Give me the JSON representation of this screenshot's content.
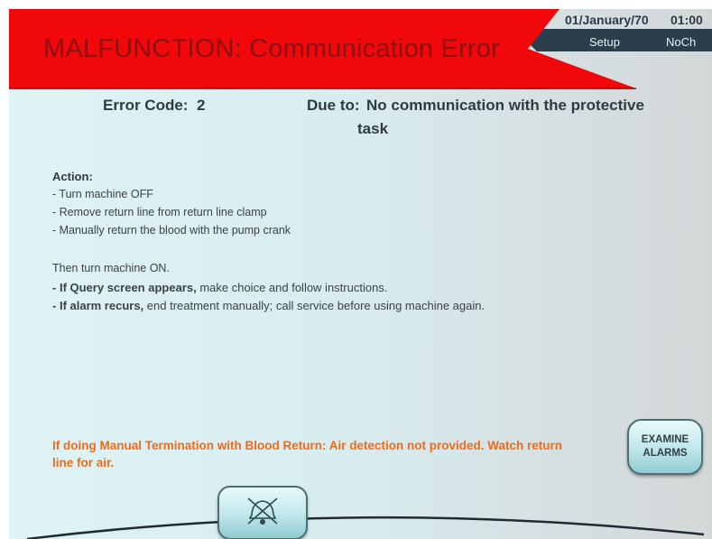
{
  "header": {
    "title": "MALFUNCTION: Communication Error",
    "date": "01/January/70",
    "time": "01:00",
    "tabs": {
      "setup": "Setup",
      "noch": "NoCh"
    }
  },
  "error": {
    "code_label": "Error Code:",
    "code_value": "2",
    "due_label": "Due to:",
    "due_line1": "No communication with the protective",
    "due_line2": "task"
  },
  "action": {
    "title": "Action:",
    "steps": [
      "- Turn machine OFF",
      "- Remove return line from return line clamp",
      "- Manually return the blood with the pump crank"
    ],
    "then": "Then turn machine ON.",
    "ifs": [
      {
        "prefix": "- ",
        "bold": "If Query screen appears,",
        "rest": " make choice and follow instructions."
      },
      {
        "prefix": "- ",
        "bold": "If alarm recurs,",
        "rest": " end treatment manually; call service before using machine again."
      }
    ]
  },
  "warning": "If doing Manual Termination with Blood Return: Air detection not provided. Watch return line for air.",
  "buttons": {
    "examine_line1": "EXAMINE",
    "examine_line2": "ALARMS",
    "silence_icon": "alarm-silence-icon"
  },
  "colors": {
    "header_red": "#f0080a",
    "title_text": "#8e0f12",
    "tab_bar": "#2b3e4c",
    "warning_orange": "#ef6b18"
  }
}
